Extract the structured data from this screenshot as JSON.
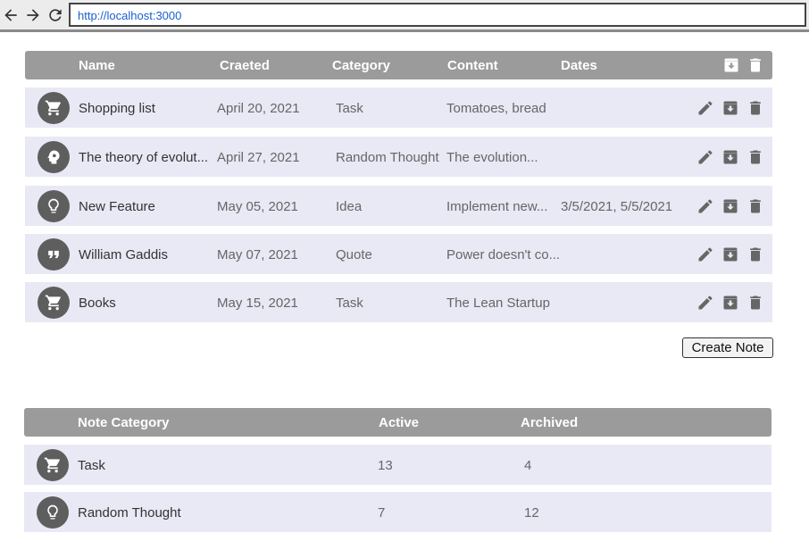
{
  "browser": {
    "url": "http://localhost:3000",
    "icons": [
      "back-arrow-icon",
      "forward-arrow-icon",
      "reload-icon"
    ]
  },
  "notes": {
    "headers": {
      "name": "Name",
      "created": "Craeted",
      "category": "Category",
      "content": "Content",
      "dates": "Dates"
    },
    "rows": [
      {
        "icon": "cart",
        "name": "Shopping list",
        "created": "April 20, 2021",
        "category": "Task",
        "content": "Tomatoes, bread",
        "dates": ""
      },
      {
        "icon": "head-gear",
        "name": "The theory of evolut...",
        "created": "April 27, 2021",
        "category": "Random Thought",
        "content": "The evolution...",
        "dates": ""
      },
      {
        "icon": "lightbulb",
        "name": "New Feature",
        "created": "May 05, 2021",
        "category": "Idea",
        "content": "Implement new...",
        "dates": "3/5/2021, 5/5/2021"
      },
      {
        "icon": "quote",
        "name": "William Gaddis",
        "created": "May 07, 2021",
        "category": "Quote",
        "content": "Power doesn't co...",
        "dates": ""
      },
      {
        "icon": "cart",
        "name": "Books",
        "created": "May 15, 2021",
        "category": "Task",
        "content": "The Lean Startup",
        "dates": ""
      }
    ],
    "create_label": "Create Note"
  },
  "stats": {
    "headers": {
      "category": "Note Category",
      "active": "Active",
      "archived": "Archived"
    },
    "rows": [
      {
        "icon": "cart",
        "category": "Task",
        "active": "13",
        "archived": "4"
      },
      {
        "icon": "lightbulb",
        "category": "Random Thought",
        "active": "7",
        "archived": "12"
      }
    ]
  },
  "colors": {
    "header": "#9b9b9b",
    "row": "#e8e9f5",
    "icon_circle": "#5e5e5e",
    "link": "#1a5fd0"
  }
}
